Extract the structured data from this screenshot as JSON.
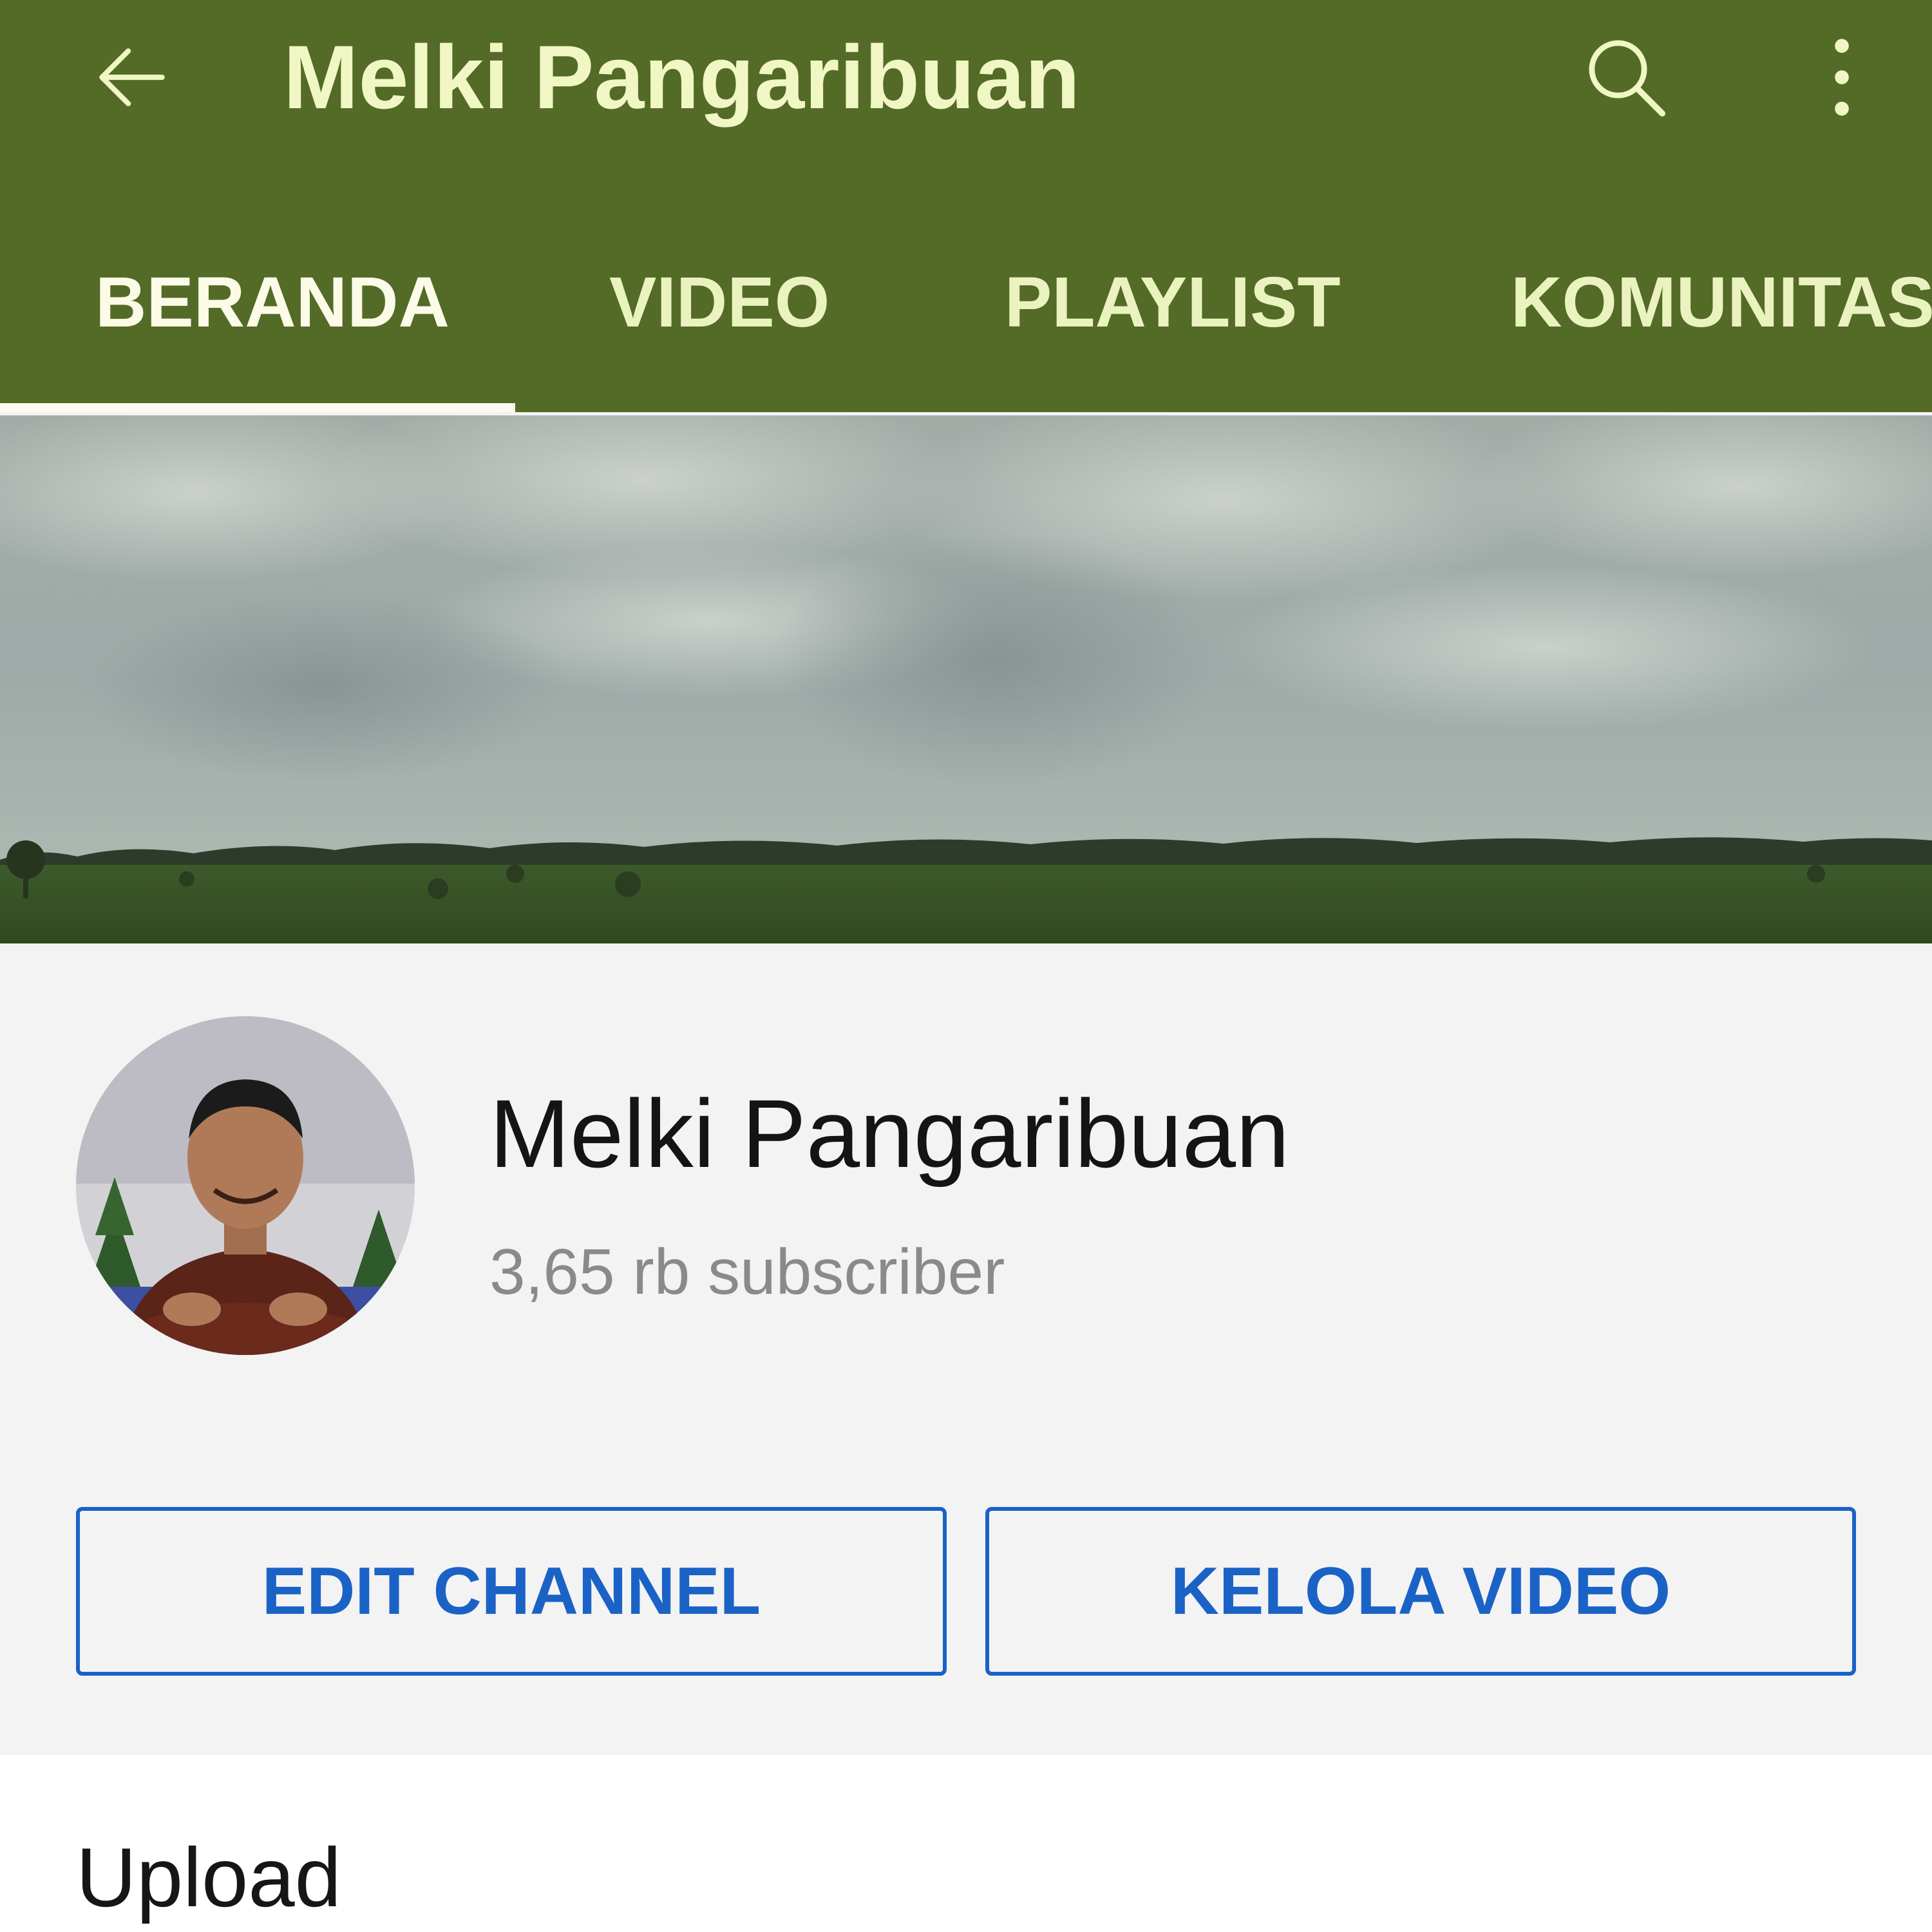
{
  "header": {
    "title": "Melki Pangaribuan",
    "background_color": "#546a27",
    "text_color": "#f0f6c4",
    "icons": [
      "arrow-back-icon",
      "search-icon",
      "more-vert-icon"
    ]
  },
  "tabs": [
    {
      "label": "BERANDA",
      "active": true
    },
    {
      "label": "VIDEO",
      "active": false
    },
    {
      "label": "PLAYLIST",
      "active": false
    },
    {
      "label": "KOMUNITAS",
      "active": false
    }
  ],
  "channel": {
    "name": "Melki Pangaribuan",
    "subscribers": "3,65 rb subscriber"
  },
  "actions": {
    "edit_label": "EDIT CHANNEL",
    "manage_label": "KELOLA VIDEO",
    "accent_color": "#1a62c6"
  },
  "uploads": {
    "heading": "Upload"
  }
}
